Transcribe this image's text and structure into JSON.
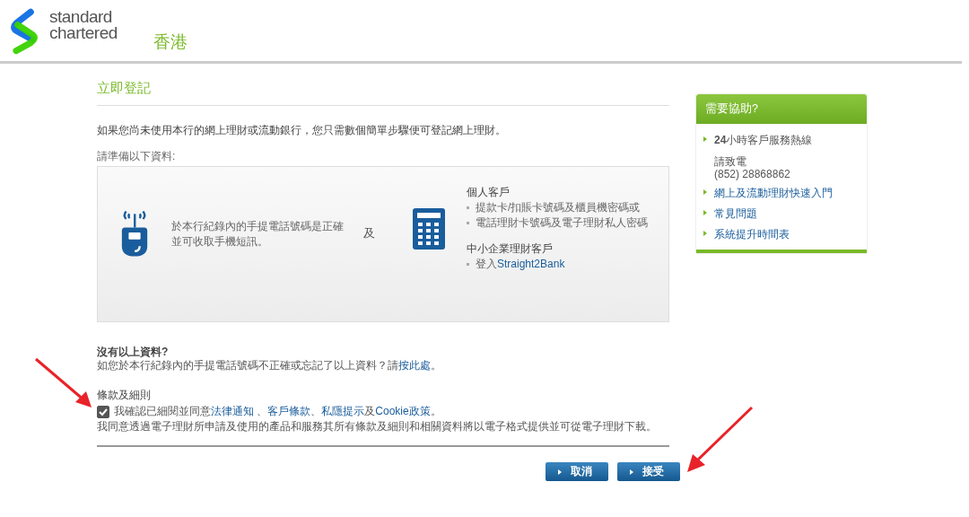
{
  "header": {
    "logo_text": [
      "standard",
      "chartered"
    ],
    "region": "香港"
  },
  "page_title": "立即登記",
  "intro": "如果您尚未使用本行的網上理財或流動銀行，您只需數個簡單步驟便可登記網上理財。",
  "prepare_label": "請準備以下資料:",
  "requirements": {
    "phone_text": "於本行紀錄內的手提電話號碼是正確並可收取手機短訊。",
    "and": "及",
    "groups": [
      {
        "title": "個人客戶",
        "items": [
          {
            "parts": [
              {
                "text": "提款卡/扣賬卡號碼及櫃員機密碼或",
                "link": false
              }
            ]
          },
          {
            "parts": [
              {
                "text": "電話理財卡號碼及電子理財私人密碼",
                "link": false
              }
            ]
          }
        ]
      },
      {
        "title": "中小企業理財客戶",
        "items": [
          {
            "parts": [
              {
                "text": "登入",
                "link": false
              },
              {
                "text": "Straight2Bank",
                "link": true
              }
            ]
          }
        ]
      }
    ]
  },
  "no_info": {
    "title": "沒有以上資料?",
    "parts": [
      {
        "text": "如您於本行紀錄內的手提電話號碼不正確或忘記了以上資料？請",
        "link": false
      },
      {
        "text": "按此處",
        "link": true
      },
      {
        "text": "。",
        "link": false
      }
    ]
  },
  "terms": {
    "title": "條款及細則",
    "checked": true,
    "parts": [
      {
        "text": "我確認已細閱並同意",
        "link": false
      },
      {
        "text": "法律通知",
        "link": true
      },
      {
        "text": " 、",
        "link": false
      },
      {
        "text": "客戶條款",
        "link": true
      },
      {
        "text": "、",
        "link": false
      },
      {
        "text": "私隱提示",
        "link": true
      },
      {
        "text": "及",
        "link": false
      },
      {
        "text": "Cookie政策",
        "link": true
      },
      {
        "text": "。",
        "link": false
      }
    ],
    "note": "我同意透過電子理財所申請及使用的產品和服務其所有條款及細則和相關資料將以電子格式提供並可從電子理財下載。"
  },
  "buttons": [
    "取消",
    "接受"
  ],
  "help": {
    "title": "需要協助?",
    "items": [
      {
        "kind": "info",
        "text": "**24**小時客戶服務熱線",
        "lines": [
          "請致電",
          "(852) 28868862"
        ]
      },
      {
        "kind": "link",
        "text": "網上及流動理財快速入門"
      },
      {
        "kind": "link",
        "text": "常見問題"
      },
      {
        "kind": "link",
        "text": "系統提升時間表"
      }
    ]
  }
}
